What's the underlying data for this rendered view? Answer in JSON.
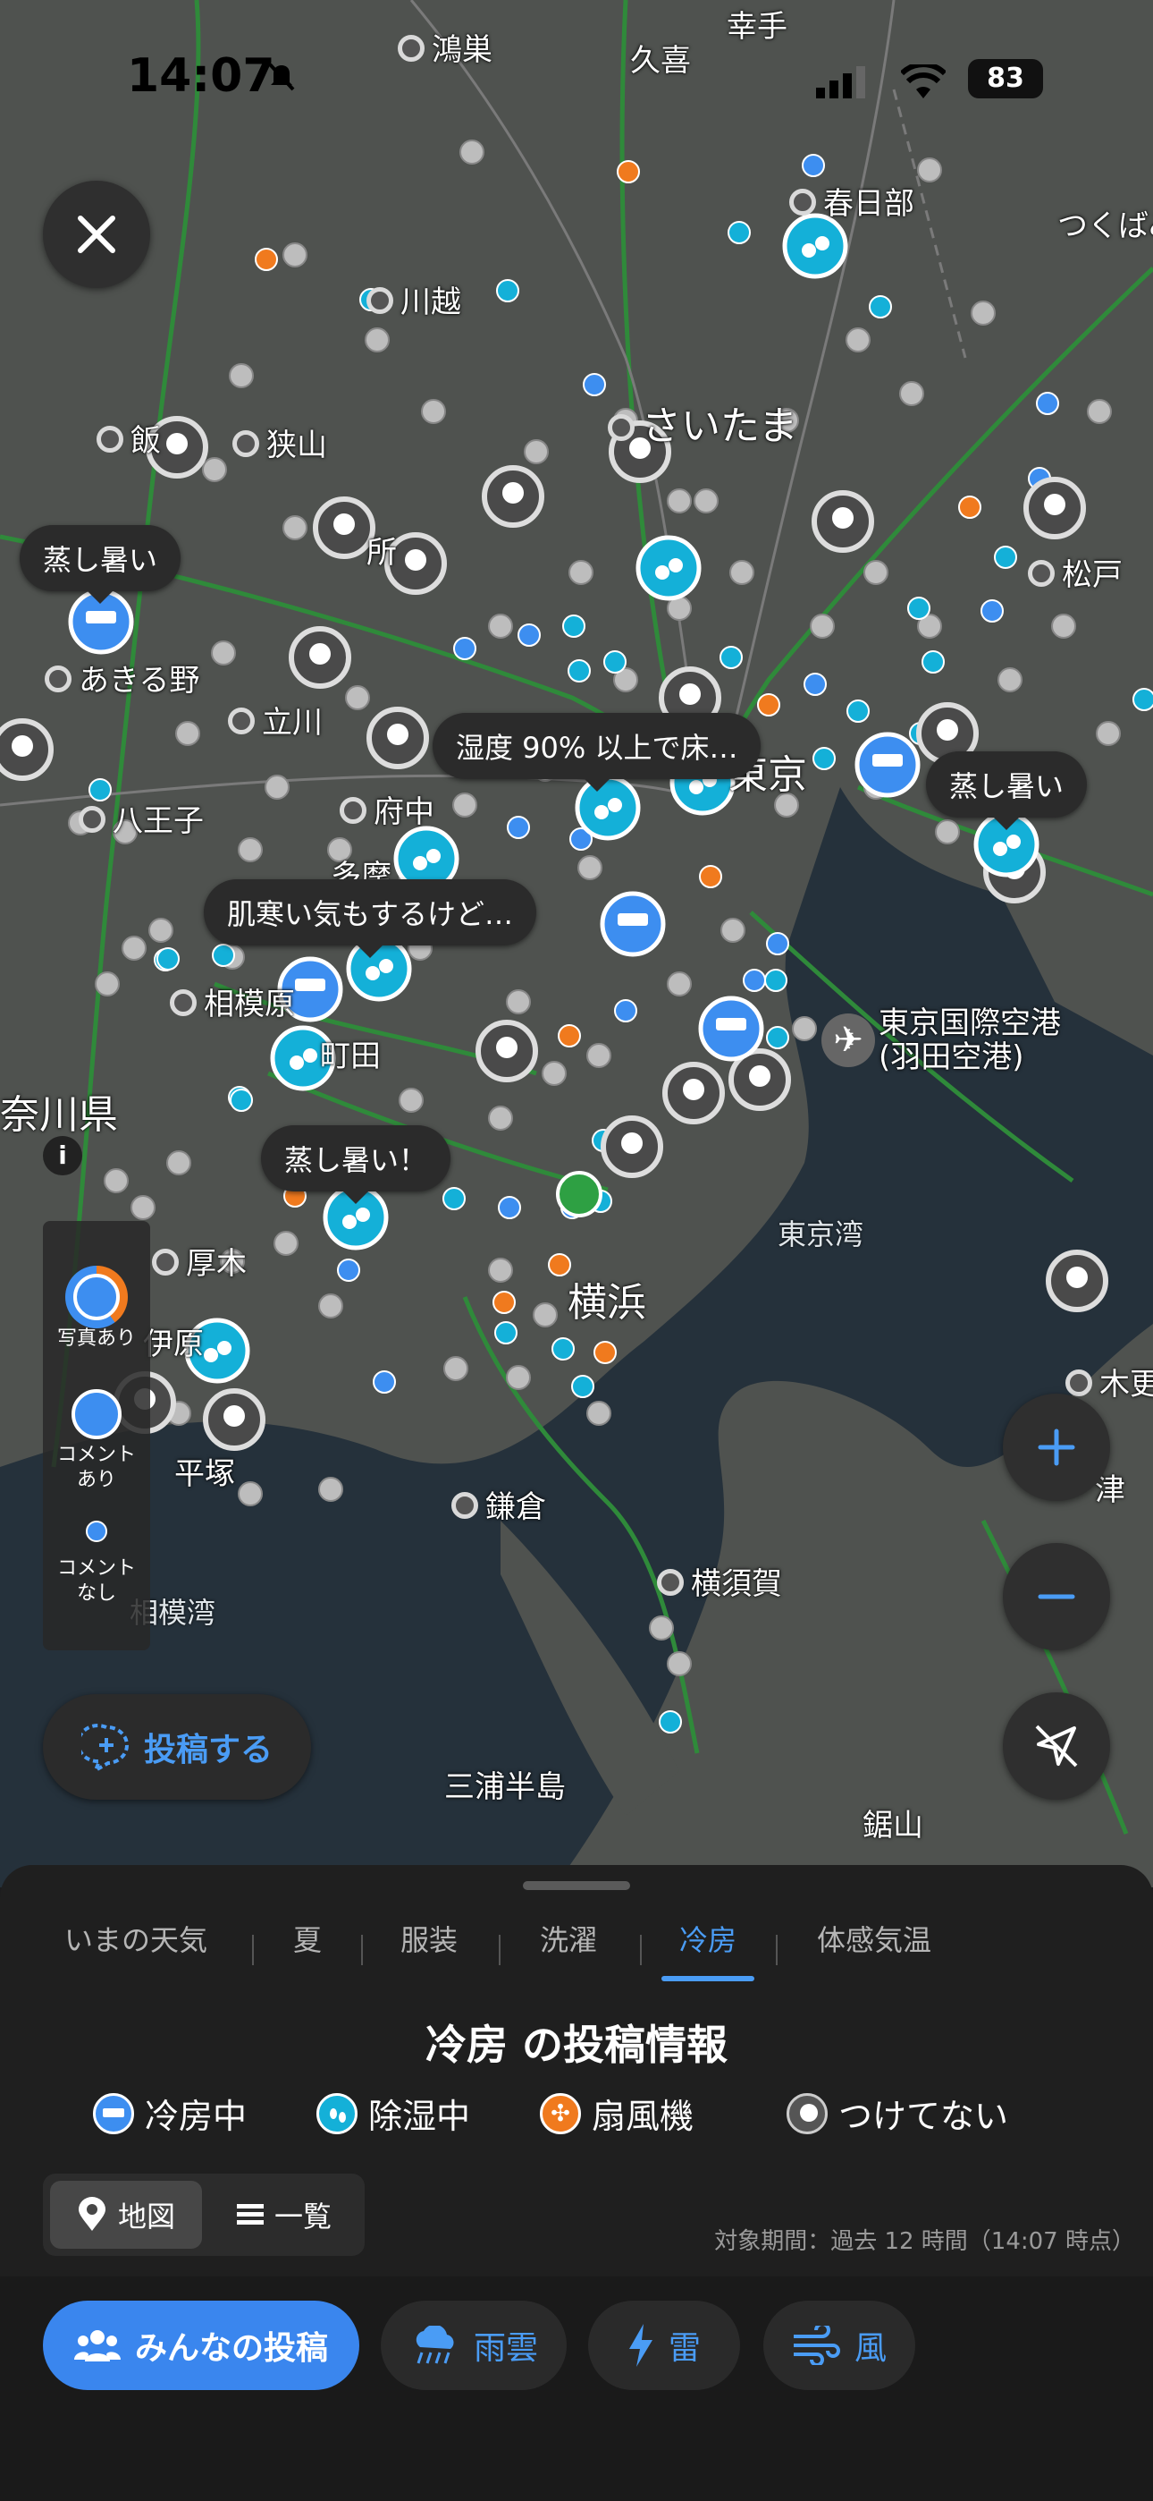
{
  "status_bar": {
    "time": "14:07",
    "battery": "83"
  },
  "map": {
    "places": [
      {
        "name": "鴻巣"
      },
      {
        "name": "久喜"
      },
      {
        "name": "幸手"
      },
      {
        "name": "春日部"
      },
      {
        "name": "つくばみ"
      },
      {
        "name": "川越"
      },
      {
        "name": "狭山"
      },
      {
        "name": "飯"
      },
      {
        "name": "さいたま"
      },
      {
        "name": "松戸"
      },
      {
        "name": "所"
      },
      {
        "name": "あきる野"
      },
      {
        "name": "立川"
      },
      {
        "name": "八王子"
      },
      {
        "name": "府中"
      },
      {
        "name": "多摩"
      },
      {
        "name": "東京"
      },
      {
        "name": "相模原"
      },
      {
        "name": "町田"
      },
      {
        "name": "奈川県"
      },
      {
        "name": "東京国際空港\n(羽田空港)"
      },
      {
        "name": "厚木"
      },
      {
        "name": "東京湾"
      },
      {
        "name": "横浜"
      },
      {
        "name": "平塚"
      },
      {
        "name": "鎌倉"
      },
      {
        "name": "相模湾"
      },
      {
        "name": "横須賀"
      },
      {
        "name": "木更"
      },
      {
        "name": "津"
      },
      {
        "name": "三浦半島"
      },
      {
        "name": "鋸山"
      },
      {
        "name": "伊原"
      }
    ],
    "callouts": [
      "蒸し暑い",
      "湿度 90% 以上で床…",
      "蒸し暑い",
      "肌寒い気もするけど…",
      "蒸し暑い！"
    ],
    "info_label": "i"
  },
  "legend": {
    "photo": "写真あり",
    "comment": "コメント\nあり",
    "no_comment": "コメント\nなし"
  },
  "post_button": {
    "label": "投稿する"
  },
  "sheet": {
    "tabs": [
      "いまの天気",
      "夏",
      "服装",
      "洗濯",
      "冷房",
      "体感気温"
    ],
    "active_tab": "冷房",
    "heading": "冷房 の投稿情報",
    "categories": [
      {
        "label": "冷房中",
        "color": "#3d8ef0"
      },
      {
        "label": "除湿中",
        "color": "#14b0d8"
      },
      {
        "label": "扇風機",
        "color": "#f07a1e"
      },
      {
        "label": "つけてない",
        "color": "#9a9a9a"
      }
    ],
    "view_map": "地図",
    "view_list": "一覧",
    "period": "対象期間：過去 12 時間（14:07 時点）"
  },
  "layers": {
    "posts": "みんなの投稿",
    "rain": "雨雲",
    "thunder": "雷",
    "wind": "風"
  },
  "colors": {
    "accent": "#4a9cf5",
    "cool": "#3d8ef0",
    "dehumid": "#14b0d8",
    "fan": "#f07a1e",
    "off": "#9a9a9a"
  }
}
